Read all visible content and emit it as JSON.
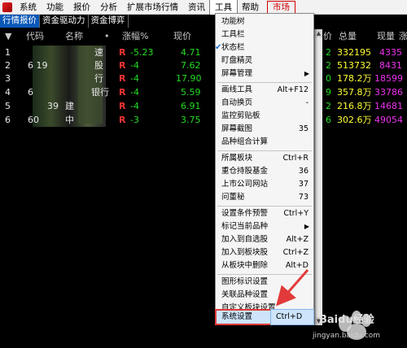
{
  "menubar": {
    "items": [
      "系统",
      "功能",
      "报价",
      "分析",
      "扩展市场行情",
      "资讯",
      "工具",
      "帮助"
    ],
    "market_label": "市场"
  },
  "tabs": [
    "行情报价",
    "资金驱动力",
    "资金博弈"
  ],
  "table": {
    "headers": {
      "marker": "▼",
      "code": "代码",
      "name": "名称",
      "dot": "•",
      "change_pct": "涨幅%",
      "price": "现价",
      "gu": "价",
      "total_vol": "总量",
      "cur_vol": "现量",
      "more": "涨"
    },
    "rows": [
      {
        "idx": "1",
        "code": "",
        "name": "速",
        "flag": "R",
        "change": "-5.23",
        "price": "4.71",
        "chg2": "2",
        "total_vol": "332195",
        "cur_vol": "4335"
      },
      {
        "idx": "2",
        "code": "6  19",
        "name": "股",
        "flag": "R",
        "change": "-4",
        "price": "7.62",
        "chg2": "2",
        "total_vol": "513732",
        "cur_vol": "8431"
      },
      {
        "idx": "3",
        "code": "",
        "name": "行",
        "flag": "R",
        "change": "-4",
        "price": "17.90",
        "chg2": "0",
        "total_vol": "178.2万",
        "cur_vol": "18599"
      },
      {
        "idx": "4",
        "code": "6",
        "name": "银行",
        "flag": "R",
        "change": "-4",
        "price": "5.59",
        "chg2": "9",
        "total_vol": "357.8万",
        "cur_vol": "33786"
      },
      {
        "idx": "5",
        "code": "39",
        "name": "建",
        "flag": "R",
        "change": "-4",
        "price": "6.91",
        "chg2": "2",
        "total_vol": "216.8万",
        "cur_vol": "14681"
      },
      {
        "idx": "6",
        "code": "60",
        "name": "中",
        "flag": "R",
        "change": "-3",
        "price": "3.75",
        "chg2": "6",
        "total_vol": "302.6万",
        "cur_vol": "49054"
      }
    ]
  },
  "dropdown": {
    "items": [
      {
        "label": "功能树",
        "shortcut": "",
        "submenu": false,
        "checked": false
      },
      {
        "label": "工具栏",
        "shortcut": "",
        "submenu": false,
        "checked": false
      },
      {
        "label": "状态栏",
        "shortcut": "",
        "submenu": false,
        "checked": true
      },
      {
        "label": "盯盘精灵",
        "shortcut": "",
        "submenu": false,
        "checked": false
      },
      {
        "label": "屏幕管理",
        "shortcut": "",
        "submenu": true,
        "checked": false
      },
      {
        "label": "画线工具",
        "shortcut": "Alt+F12",
        "submenu": false,
        "checked": false
      },
      {
        "label": "自动换页",
        "shortcut": "-",
        "submenu": false,
        "checked": false
      },
      {
        "label": "监控剪贴板",
        "shortcut": "",
        "submenu": false,
        "checked": false
      },
      {
        "label": "屏幕截图",
        "shortcut": "35",
        "submenu": false,
        "checked": false
      },
      {
        "label": "品种组合计算",
        "shortcut": "",
        "submenu": false,
        "checked": false
      },
      {
        "label": "所属板块",
        "shortcut": "Ctrl+R",
        "submenu": false,
        "checked": false
      },
      {
        "label": "重仓持股基金",
        "shortcut": "36",
        "submenu": false,
        "checked": false
      },
      {
        "label": "上市公司网站",
        "shortcut": "37",
        "submenu": false,
        "checked": false
      },
      {
        "label": "问董秘",
        "shortcut": "73",
        "submenu": false,
        "checked": false
      },
      {
        "label": "设置条件预警",
        "shortcut": "Ctrl+Y",
        "submenu": false,
        "checked": false
      },
      {
        "label": "标记当前品种",
        "shortcut": "",
        "submenu": true,
        "checked": false
      },
      {
        "label": "加入到自选股",
        "shortcut": "Alt+Z",
        "submenu": false,
        "checked": false
      },
      {
        "label": "加入到板块股",
        "shortcut": "Ctrl+Z",
        "submenu": false,
        "checked": false
      },
      {
        "label": "从板块中删除",
        "shortcut": "Alt+D",
        "submenu": false,
        "checked": false
      },
      {
        "label": "图形标识设置",
        "shortcut": "",
        "submenu": false,
        "checked": false
      },
      {
        "label": "关联品种设置",
        "shortcut": "",
        "submenu": false,
        "checked": false
      },
      {
        "label": "自定义板块设置",
        "shortcut": "",
        "submenu": false,
        "checked": false
      },
      {
        "label": "系统设置",
        "shortcut": "Ctrl+D",
        "submenu": false,
        "checked": false
      }
    ]
  },
  "watermark": {
    "brand": "Baidu经验",
    "url": "jingyan.baidu.com"
  },
  "colors": {
    "selected_tab": "#0a58b8",
    "annotation_red": "#e23a3a",
    "menu_highlight": "#cde4fb"
  }
}
